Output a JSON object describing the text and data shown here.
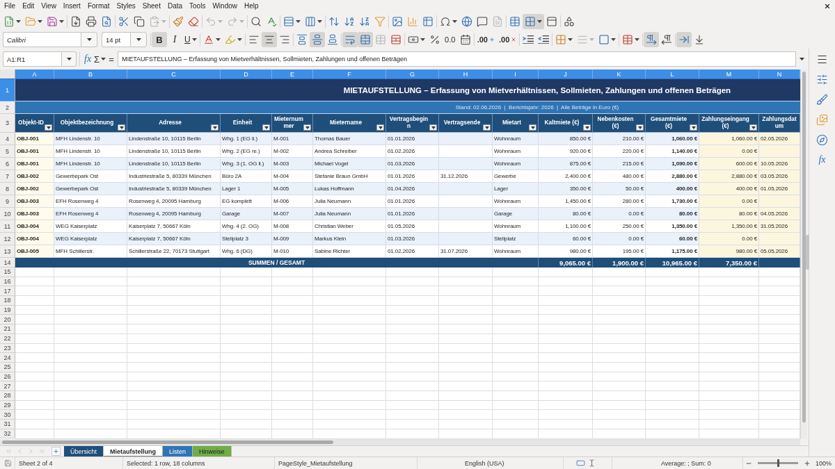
{
  "menu_bar": {
    "items": [
      "File",
      "Edit",
      "View",
      "Insert",
      "Format",
      "Styles",
      "Sheet",
      "Data",
      "Tools",
      "Window",
      "Help"
    ]
  },
  "standard_toolbar": {
    "groups": [
      [
        {
          "kind": "new",
          "dropdown": true,
          "disabled": false,
          "pressed": false
        },
        {
          "kind": "open",
          "dropdown": true,
          "disabled": false,
          "pressed": false
        },
        {
          "kind": "save",
          "dropdown": true,
          "disabled": false,
          "pressed": false
        }
      ],
      [
        {
          "kind": "export_pdf",
          "dropdown": false,
          "disabled": false,
          "pressed": false
        },
        {
          "kind": "print",
          "dropdown": false,
          "disabled": false,
          "pressed": false
        },
        {
          "kind": "print_preview",
          "dropdown": false,
          "disabled": false,
          "pressed": false
        }
      ],
      [
        {
          "kind": "cut",
          "dropdown": false,
          "disabled": false,
          "pressed": false
        },
        {
          "kind": "copy",
          "dropdown": false,
          "disabled": false,
          "pressed": false
        },
        {
          "kind": "paste",
          "dropdown": true,
          "disabled": true,
          "pressed": false
        }
      ],
      [
        {
          "kind": "clone_formatting",
          "dropdown": false,
          "disabled": false,
          "pressed": false
        },
        {
          "kind": "clear_formatting",
          "dropdown": false,
          "disabled": false,
          "pressed": false
        }
      ],
      [
        {
          "kind": "undo",
          "dropdown": true,
          "disabled": true,
          "pressed": false
        },
        {
          "kind": "redo",
          "dropdown": true,
          "disabled": true,
          "pressed": false
        }
      ],
      [
        {
          "kind": "find_replace",
          "dropdown": false,
          "disabled": false,
          "pressed": false
        },
        {
          "kind": "spelling",
          "dropdown": false,
          "disabled": false,
          "pressed": false
        }
      ],
      [
        {
          "kind": "row",
          "dropdown": true,
          "disabled": false,
          "pressed": false
        },
        {
          "kind": "column",
          "dropdown": true,
          "disabled": false,
          "pressed": false
        }
      ],
      [
        {
          "kind": "sort",
          "dropdown": false,
          "disabled": false,
          "pressed": false
        },
        {
          "kind": "sort_ascending",
          "dropdown": false,
          "disabled": false,
          "pressed": false
        },
        {
          "kind": "sort_descending",
          "dropdown": false,
          "disabled": false,
          "pressed": false
        },
        {
          "kind": "autofilter",
          "dropdown": false,
          "disabled": false,
          "pressed": false
        }
      ],
      [
        {
          "kind": "image",
          "dropdown": false,
          "disabled": false,
          "pressed": false
        },
        {
          "kind": "chart",
          "dropdown": false,
          "disabled": false,
          "pressed": false
        },
        {
          "kind": "pivot_table",
          "dropdown": false,
          "disabled": false,
          "pressed": false
        }
      ],
      [
        {
          "kind": "special_character",
          "dropdown": true,
          "disabled": false,
          "pressed": false
        },
        {
          "kind": "hyperlink",
          "dropdown": false,
          "disabled": false,
          "pressed": false
        },
        {
          "kind": "comment",
          "dropdown": false,
          "disabled": false,
          "pressed": false
        },
        {
          "kind": "header_footer",
          "dropdown": false,
          "disabled": true,
          "pressed": false
        }
      ],
      [
        {
          "kind": "print_area",
          "dropdown": false,
          "disabled": false,
          "pressed": false
        },
        {
          "kind": "freeze",
          "dropdown": true,
          "disabled": false,
          "pressed": true
        },
        {
          "kind": "split_window",
          "dropdown": false,
          "disabled": false,
          "pressed": false
        }
      ],
      [
        {
          "kind": "draw_functions",
          "dropdown": false,
          "disabled": false,
          "pressed": false
        }
      ]
    ]
  },
  "formatting_toolbar": {
    "font_name": "Calibri",
    "font_size": "14 pt",
    "groups": [
      [
        {
          "kind": "bold",
          "label": "B",
          "dropdown": false,
          "disabled": false,
          "pressed": true
        },
        {
          "kind": "italic",
          "label": "I",
          "dropdown": false,
          "disabled": false,
          "pressed": false
        },
        {
          "kind": "underline",
          "label": "U",
          "dropdown": true,
          "disabled": false,
          "pressed": false
        }
      ],
      [
        {
          "kind": "font_color",
          "dropdown": true,
          "disabled": false,
          "pressed": false
        },
        {
          "kind": "highlight",
          "dropdown": true,
          "disabled": false,
          "pressed": false
        }
      ],
      [
        {
          "kind": "align_left",
          "dropdown": false,
          "disabled": false,
          "pressed": false
        },
        {
          "kind": "align_center",
          "dropdown": false,
          "disabled": false,
          "pressed": true
        },
        {
          "kind": "align_right",
          "dropdown": false,
          "disabled": false,
          "pressed": false
        }
      ],
      [
        {
          "kind": "align_top",
          "dropdown": false,
          "disabled": false,
          "pressed": false
        },
        {
          "kind": "align_middle",
          "dropdown": false,
          "disabled": false,
          "pressed": true
        },
        {
          "kind": "align_bottom",
          "dropdown": false,
          "disabled": false,
          "pressed": false
        }
      ],
      [
        {
          "kind": "wrap_text",
          "dropdown": false,
          "disabled": false,
          "pressed": true
        },
        {
          "kind": "merge_center",
          "dropdown": false,
          "disabled": false,
          "pressed": true
        },
        {
          "kind": "merge",
          "dropdown": false,
          "disabled": true,
          "pressed": false
        },
        {
          "kind": "unmerge",
          "dropdown": false,
          "disabled": false,
          "pressed": false
        }
      ],
      [
        {
          "kind": "currency",
          "dropdown": true,
          "disabled": false,
          "pressed": false
        },
        {
          "kind": "percent",
          "dropdown": false,
          "disabled": false,
          "pressed": false
        },
        {
          "kind": "number",
          "label": "0.0",
          "dropdown": false,
          "disabled": false,
          "pressed": false
        },
        {
          "kind": "date",
          "dropdown": false,
          "disabled": false,
          "pressed": false
        }
      ],
      [
        {
          "kind": "add_decimal",
          "label": ".00",
          "dropdown": false,
          "disabled": false,
          "pressed": false
        },
        {
          "kind": "delete_decimal",
          "label": ".00",
          "dropdown": false,
          "disabled": false,
          "pressed": false
        }
      ],
      [
        {
          "kind": "indent_increase",
          "dropdown": false,
          "disabled": false,
          "pressed": false
        },
        {
          "kind": "indent_decrease",
          "dropdown": false,
          "disabled": false,
          "pressed": false
        }
      ],
      [
        {
          "kind": "borders",
          "dropdown": true,
          "disabled": false,
          "pressed": false
        },
        {
          "kind": "border_style",
          "dropdown": true,
          "disabled": true,
          "pressed": false
        },
        {
          "kind": "border_color",
          "dropdown": true,
          "disabled": false,
          "pressed": false
        }
      ],
      [
        {
          "kind": "conditional",
          "dropdown": true,
          "disabled": false,
          "pressed": false
        }
      ],
      [
        {
          "kind": "ltr",
          "dropdown": false,
          "disabled": false,
          "pressed": true
        },
        {
          "kind": "rtl",
          "dropdown": false,
          "disabled": false,
          "pressed": false
        }
      ],
      [
        {
          "kind": "text_horizontal",
          "dropdown": false,
          "disabled": false,
          "pressed": true
        },
        {
          "kind": "text_vertical",
          "dropdown": false,
          "disabled": false,
          "pressed": false
        }
      ]
    ]
  },
  "formula_bar": {
    "name_box": "A1:R1",
    "function_wizard": "fx",
    "sum": "Σ",
    "equals": "=",
    "content": "MIETAUFSTELLUNG – Erfassung von Mietverhältnissen, Sollmieten, Zahlungen und offenen Beträgen"
  },
  "sheet": {
    "columns": [
      {
        "letter": "A",
        "kind": "id",
        "selected": true
      },
      {
        "letter": "B",
        "kind": "text",
        "selected": true
      },
      {
        "letter": "C",
        "kind": "text",
        "selected": true
      },
      {
        "letter": "D",
        "kind": "text",
        "selected": true
      },
      {
        "letter": "E",
        "kind": "text",
        "selected": true
      },
      {
        "letter": "F",
        "kind": "text",
        "selected": true
      },
      {
        "letter": "G",
        "kind": "text",
        "selected": true
      },
      {
        "letter": "H",
        "kind": "text",
        "selected": true
      },
      {
        "letter": "I",
        "kind": "text",
        "selected": true
      },
      {
        "letter": "J",
        "kind": "amount",
        "selected": true
      },
      {
        "letter": "K",
        "kind": "amount",
        "selected": true
      },
      {
        "letter": "L",
        "kind": "sum",
        "selected": true
      },
      {
        "letter": "M",
        "kind": "payment",
        "selected": true
      },
      {
        "letter": "N",
        "kind": "payment_date",
        "selected": true
      }
    ],
    "rows": [
      {
        "kind": "title",
        "number": "1",
        "selected": true,
        "text": "MIETAUFSTELLUNG – Erfassung von Mietverhältnissen, Sollmieten, Zahlungen und offenen Beträgen"
      },
      {
        "kind": "subtitle",
        "number": "2",
        "selected": false,
        "text": "Stand: 02.06.2026  |  Berichtsjahr: 2026  |  Alle Beträge in Euro (€)"
      },
      {
        "kind": "header",
        "number": "3",
        "selected": false,
        "cells": [
          {
            "text": "Objekt-ID",
            "filter": true
          },
          {
            "text": "Objektbezeichnung",
            "filter": true
          },
          {
            "text": "Adresse",
            "filter": true
          },
          {
            "text": "Einheit",
            "filter": true
          },
          {
            "text": "Mieternummer",
            "filter": true
          },
          {
            "text": "Mietername",
            "filter": true
          },
          {
            "text": "Vertragsbeginn",
            "filter": true
          },
          {
            "text": "Vertragsende",
            "filter": true
          },
          {
            "text": "Mietart",
            "filter": true
          },
          {
            "text": "Kaltmiete (€)",
            "filter": true
          },
          {
            "text": "Nebenkosten (€)",
            "filter": true
          },
          {
            "text": "Gesamtmiete (€)",
            "filter": true
          },
          {
            "text": "Zahlungseingang (€)",
            "filter": true
          },
          {
            "text": "Zahlungsdatum",
            "filter": false
          }
        ]
      },
      {
        "kind": "data",
        "number": "4",
        "selected": false,
        "cells": [
          "OBJ-001",
          "MFH Lindenstr. 10",
          "Lindenstraße 10, 10115 Berlin",
          "Whg. 1 (EG li.)",
          "M-001",
          "Thomas Bauer",
          "01.01.2026",
          null,
          "Wohnraum",
          "850.00 €",
          "210.00 €",
          "1,060.00 €",
          "1,060.00 €",
          "02.05.2026"
        ]
      },
      {
        "kind": "data",
        "number": "5",
        "selected": false,
        "cells": [
          "OBJ-001",
          "MFH Lindenstr. 10",
          "Lindenstraße 10, 10115 Berlin",
          "Whg. 2 (EG re.)",
          "M-002",
          "Andrea Schreiber",
          "01.02.2026",
          null,
          "Wohnraum",
          "920.00 €",
          "220.00 €",
          "1,140.00 €",
          "0.00 €",
          null
        ]
      },
      {
        "kind": "data",
        "number": "6",
        "selected": false,
        "cells": [
          "OBJ-001",
          "MFH Lindenstr. 10",
          "Lindenstraße 10, 10115 Berlin",
          "Whg. 3 (1. OG li.)",
          "M-003",
          "Michael Vogel",
          "01.03.2026",
          null,
          "Wohnraum",
          "875.00 €",
          "215.00 €",
          "1,090.00 €",
          "600.00 €",
          "10.05.2026"
        ]
      },
      {
        "kind": "data",
        "number": "7",
        "selected": false,
        "cells": [
          "OBJ-002",
          "Gewerbepark Ost",
          "Industriestraße 5, 80339 München",
          "Büro 2A",
          "M-004",
          "Stefanie Braun GmbH",
          "01.01.2026",
          "31.12.2026",
          "Gewerbe",
          "2,400.00 €",
          "480.00 €",
          "2,880.00 €",
          "2,880.00 €",
          "03.05.2026"
        ]
      },
      {
        "kind": "data",
        "number": "8",
        "selected": false,
        "cells": [
          "OBJ-002",
          "Gewerbepark Ost",
          "Industriestraße 5, 80339 München",
          "Lager 1",
          "M-005",
          "Lukas Hoffmann",
          "01.04.2026",
          null,
          "Lager",
          "350.00 €",
          "50.00 €",
          "400.00 €",
          "400.00 €",
          "01.05.2026"
        ]
      },
      {
        "kind": "data",
        "number": "9",
        "selected": false,
        "cells": [
          "OBJ-003",
          "EFH Rosenweg 4",
          "Rosenweg 4, 20095 Hamburg",
          "EG komplett",
          "M-006",
          "Julia Neumann",
          "01.01.2026",
          null,
          "Wohnraum",
          "1,450.00 €",
          "280.00 €",
          "1,730.00 €",
          "0.00 €",
          null
        ]
      },
      {
        "kind": "data",
        "number": "10",
        "selected": false,
        "cells": [
          "OBJ-003",
          "EFH Rosenweg 4",
          "Rosenweg 4, 20095 Hamburg",
          "Garage",
          "M-007",
          "Julia Neumann",
          "01.01.2026",
          null,
          "Garage",
          "80.00 €",
          "0.00 €",
          "80.00 €",
          "80.00 €",
          "04.05.2026"
        ]
      },
      {
        "kind": "data",
        "number": "11",
        "selected": false,
        "cells": [
          "OBJ-004",
          "WEG Kaiserplatz",
          "Kaiserplatz 7, 50667 Köln",
          "Whg. 4 (2. OG)",
          "M-008",
          "Christian Weber",
          "01.05.2026",
          null,
          "Wohnraum",
          "1,100.00 €",
          "250.00 €",
          "1,350.00 €",
          "1,350.00 €",
          "31.05.2026"
        ]
      },
      {
        "kind": "data",
        "number": "12",
        "selected": false,
        "cells": [
          "OBJ-004",
          "WEG Kaiserplatz",
          "Kaiserplatz 7, 50667 Köln",
          "Stellplatz 3",
          "M-009",
          "Markus Klein",
          "01.03.2026",
          null,
          "Stellplatz",
          "60.00 €",
          "0.00 €",
          "60.00 €",
          "0.00 €",
          null
        ]
      },
      {
        "kind": "data",
        "number": "13",
        "selected": false,
        "cells": [
          "OBJ-005",
          "MFH Schillerstr.",
          "Schillerstraße 22, 70173 Stuttgart",
          "Whg. 6 (DG)",
          "M-010",
          "Sabine Richter",
          "01.02.2026",
          "31.07.2026",
          "Wohnraum",
          "980.00 €",
          "195.00 €",
          "1,175.00 €",
          "980.00 €",
          "05.05.2026"
        ]
      },
      {
        "kind": "total",
        "number": "14",
        "selected": false,
        "label": "SUMMEN / GESAMT",
        "totals": [
          "9,065.00 €",
          "1,900.00 €",
          "10,965.00 €",
          "7,350.00 €"
        ]
      },
      {
        "kind": "empty",
        "number": "15",
        "selected": false
      },
      {
        "kind": "empty",
        "number": "16",
        "selected": false
      },
      {
        "kind": "empty",
        "number": "17",
        "selected": false
      },
      {
        "kind": "empty",
        "number": "18",
        "selected": false
      },
      {
        "kind": "empty",
        "number": "19",
        "selected": false
      },
      {
        "kind": "empty",
        "number": "20",
        "selected": false
      },
      {
        "kind": "empty",
        "number": "21",
        "selected": false
      },
      {
        "kind": "empty",
        "number": "22",
        "selected": false
      },
      {
        "kind": "empty",
        "number": "23",
        "selected": false
      },
      {
        "kind": "empty",
        "number": "24",
        "selected": false
      },
      {
        "kind": "empty",
        "number": "25",
        "selected": false
      },
      {
        "kind": "empty",
        "number": "26",
        "selected": false
      },
      {
        "kind": "empty",
        "number": "27",
        "selected": false
      },
      {
        "kind": "empty",
        "number": "28",
        "selected": false
      },
      {
        "kind": "empty",
        "number": "29",
        "selected": false
      },
      {
        "kind": "empty",
        "number": "30",
        "selected": false
      },
      {
        "kind": "empty",
        "number": "31",
        "selected": false
      },
      {
        "kind": "empty",
        "number": "32",
        "selected": false
      }
    ]
  },
  "sheet_navigation": [
    {
      "kind": "first",
      "disabled": true
    },
    {
      "kind": "previous",
      "disabled": true
    },
    {
      "kind": "next",
      "disabled": true
    },
    {
      "kind": "last",
      "disabled": true
    }
  ],
  "sheet_tabs": [
    {
      "label": "Übersicht",
      "selected": false,
      "color": "#1f4e79"
    },
    {
      "label": "Mietaufstellung",
      "selected": true
    },
    {
      "label": "Listen",
      "selected": false,
      "color": "#2e75b6"
    },
    {
      "label": "Hinweise",
      "selected": false,
      "color": "#70ad47"
    }
  ],
  "status_bar": {
    "sheet": "Sheet 2 of 4",
    "selection": "Selected: 1 row, 18 columns",
    "page_style": "PageStyle_Mietaufstellung",
    "language": "English (USA)",
    "statistics": "Average: ; Sum: 0",
    "zoom": {
      "level": 0.5,
      "reading": "100%"
    }
  },
  "sidebar": {
    "items": [
      {
        "kind": "menu"
      },
      {
        "kind": "properties"
      },
      {
        "kind": "styles"
      },
      {
        "kind": "gallery"
      },
      {
        "kind": "navigator"
      },
      {
        "kind": "functions",
        "label": "fx"
      }
    ]
  }
}
